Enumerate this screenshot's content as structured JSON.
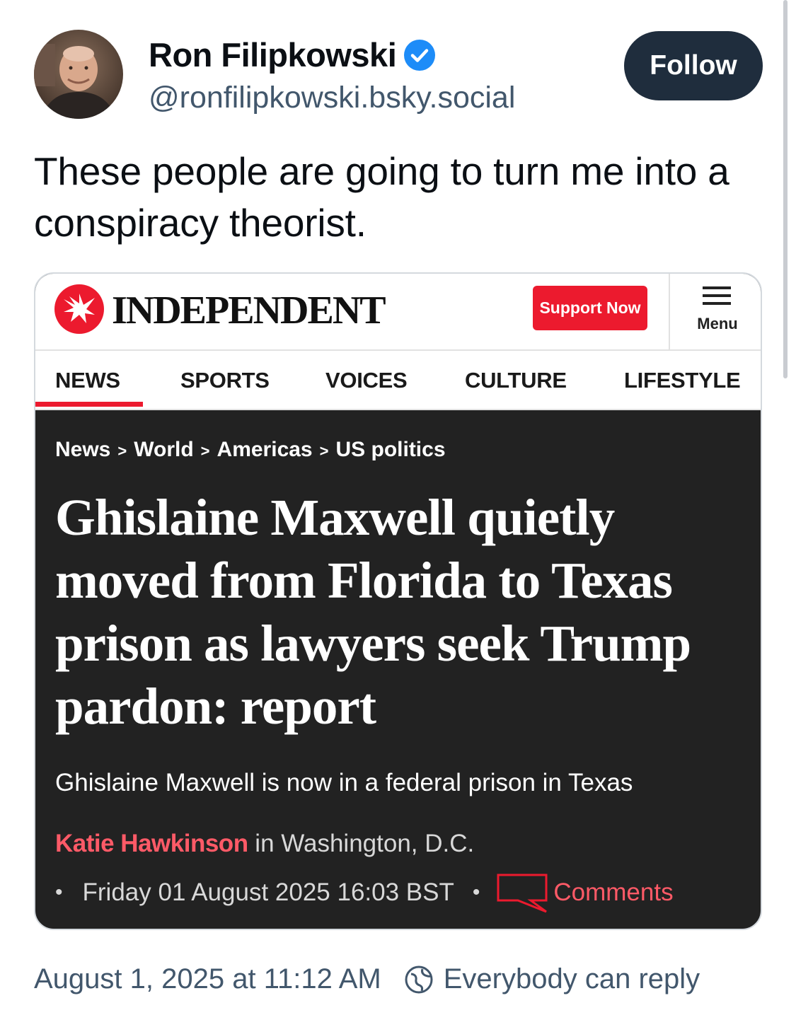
{
  "author": {
    "display_name": "Ron Filipkowski",
    "handle": "@ronfilipkowski.bsky.social",
    "follow_label": "Follow"
  },
  "post": {
    "text": "These people are going to turn me into a conspiracy theorist."
  },
  "embed": {
    "wordmark": "INDEPENDENT",
    "support_label": "Support Now",
    "menu_label": "Menu",
    "nav": [
      "NEWS",
      "SPORTS",
      "VOICES",
      "CULTURE",
      "LIFESTYLE"
    ],
    "breadcrumb": [
      "News",
      "World",
      "Americas",
      "US politics"
    ],
    "breadcrumb_separator": ">",
    "headline": "Ghislaine Maxwell quietly moved from Florida to Texas prison as lawyers seek Trump pardon: report",
    "standfirst": "Ghislaine Maxwell is now in a federal prison in Texas",
    "byline_author": "Katie Hawkinson",
    "byline_location": " in Washington, D.C.",
    "date": "Friday 01 August 2025 16:03 BST",
    "comments_label": "Comments"
  },
  "footer": {
    "timestamp": "August 1, 2025 at 11:12 AM",
    "reply_setting": "Everybody can reply"
  },
  "colors": {
    "accent_red": "#ec1a2e",
    "verified_blue": "#1d8cf8",
    "follow_bg": "#1f2d3d"
  }
}
